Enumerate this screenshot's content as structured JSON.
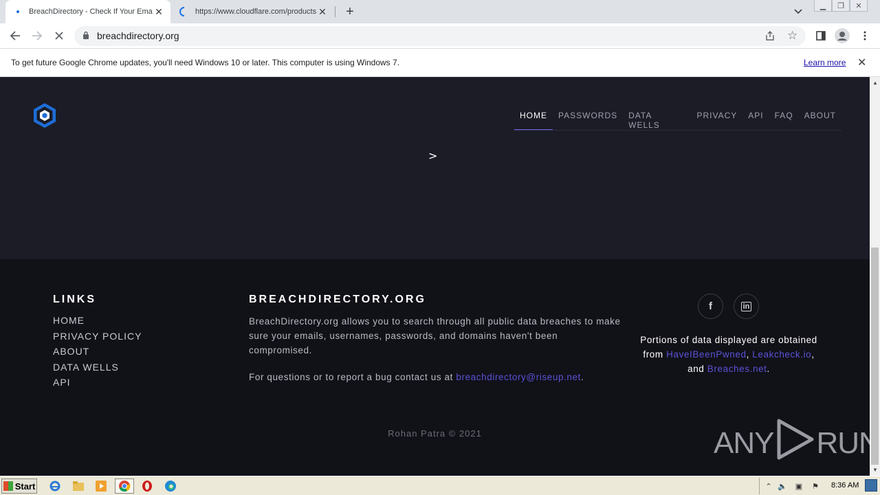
{
  "browser": {
    "tabs": [
      {
        "title": "BreachDirectory - Check If Your Email or Username was Compromised",
        "active": true
      },
      {
        "title": "https://www.cloudflare.com/products/tunnel/",
        "active": false
      }
    ],
    "address": "breachdirectory.org",
    "infobar": {
      "message": "To get future Google Chrome updates, you'll need Windows 10 or later. This computer is using Windows 7.",
      "link": "Learn more"
    }
  },
  "site": {
    "nav": [
      "HOME",
      "PASSWORDS",
      "DATA WELLS",
      "PRIVACY",
      "API",
      "FAQ",
      "ABOUT"
    ],
    "hero_mark": ">",
    "footer": {
      "links_title": "LINKS",
      "links": [
        "HOME",
        "PRIVACY POLICY",
        "ABOUT",
        "DATA WELLS",
        "API"
      ],
      "brand_title": "BREACHDIRECTORY.ORG",
      "about_text": "BreachDirectory.org allows you to search through all public data breaches to make sure your emails, usernames, passwords, and domains haven't been compromised.",
      "contact_prefix": "For questions or to report a bug contact us at ",
      "contact_email": "breachdirectory@riseup.net",
      "contact_suffix": ".",
      "social": [
        {
          "icon": "facebook-icon",
          "glyph": "f"
        },
        {
          "icon": "linkedin-icon",
          "glyph": "in"
        }
      ],
      "sources_prefix": "Portions of data displayed are obtained from ",
      "source_1": "HaveIBeenPwned",
      "sep_1": ", ",
      "source_2": "Leakcheck.io",
      "sep_2": ", and ",
      "source_3": "Breaches.net",
      "sources_suffix": ".",
      "copyright": "Rohan Patra © 2021"
    }
  },
  "watermark": {
    "left": "ANY",
    "right": "RUN"
  },
  "taskbar": {
    "start_label": "Start",
    "clock": "8:36 AM"
  },
  "colors": {
    "hero_bg": "#1b1c26",
    "footer_bg": "#111118",
    "accent": "#5b52d6",
    "logo_blue": "#1e6ed8"
  }
}
